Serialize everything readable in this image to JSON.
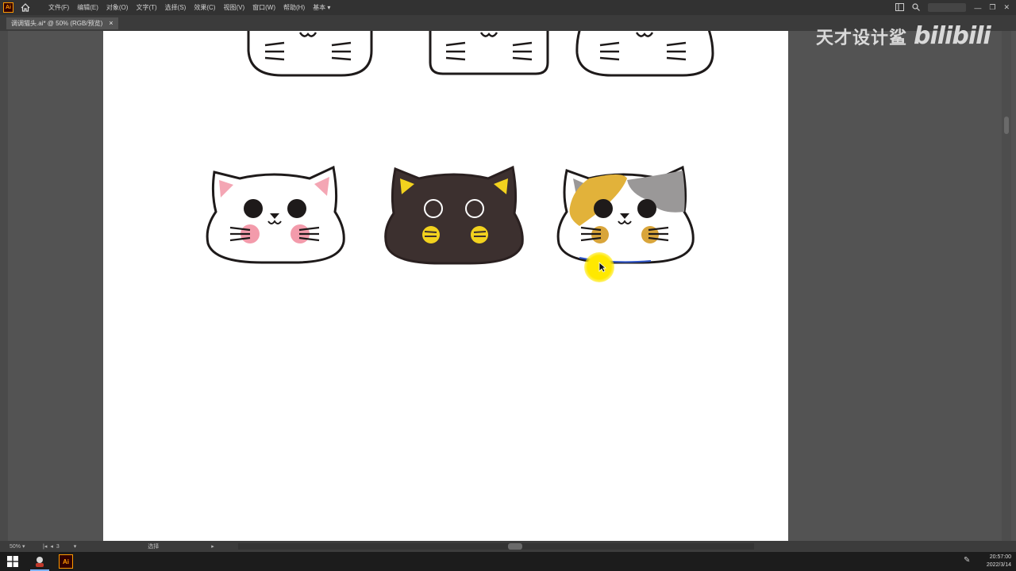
{
  "app": {
    "logo_text": "Ai",
    "accent": "#ff9a00"
  },
  "menu": {
    "items": [
      "文件(F)",
      "编辑(E)",
      "对象(O)",
      "文字(T)",
      "选择(S)",
      "效果(C)",
      "视图(V)",
      "窗口(W)",
      "帮助(H)"
    ],
    "workspace_label": "基本"
  },
  "document": {
    "tab_title": "调调猫头.ai* @ 50% (RGB/预览)"
  },
  "watermark": {
    "text": "天才设计鲨",
    "brand": "bilibili"
  },
  "status": {
    "zoom": "50%",
    "artboard_index": "3",
    "tool": "选择"
  },
  "taskbar": {
    "time": "20:57:00",
    "date": "2022/3/14",
    "app_label": "Ai"
  },
  "canvas": {
    "background": "#ffffff",
    "cats": [
      {
        "name": "white-cat",
        "fill": "#ffffff",
        "ear_inner": "#f4a6b4",
        "cheek": "#f39bab"
      },
      {
        "name": "black-cat",
        "fill": "#3c302f",
        "ear_inner": "#f2d21e",
        "cheek": "#f2d21e"
      },
      {
        "name": "calico-cat",
        "fill": "#ffffff",
        "patch_orange": "#e2b23a",
        "patch_gray": "#9a9898",
        "cheek": "#d9a53a"
      }
    ]
  }
}
